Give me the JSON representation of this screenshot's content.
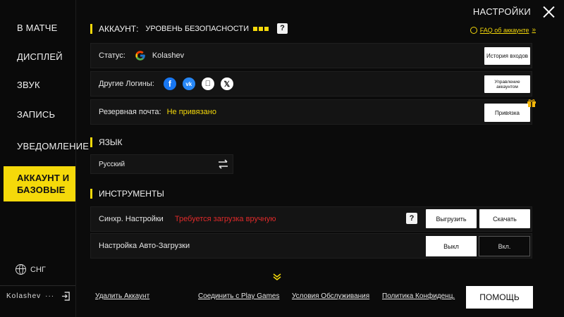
{
  "sidebar": {
    "items": [
      {
        "label": "В МАТЧЕ"
      },
      {
        "label": "ДИСПЛЕЙ"
      },
      {
        "label": "ЗВУК"
      },
      {
        "label": "ЗАПИСЬ"
      },
      {
        "label": "УВЕДОМЛЕНИЕ"
      },
      {
        "label_line1": "АККАУНТ И",
        "label_line2": "БАЗОВЫЕ",
        "active": true
      }
    ],
    "region": "СНГ",
    "username": "Kolashev",
    "user_more": "···"
  },
  "header": {
    "title": "НАСТРОЙКИ"
  },
  "account": {
    "title": "АККАУНТ:",
    "security_level": "УРОВЕНЬ БЕЗОПАСНОСТИ",
    "security_dots": 3,
    "help_icon": "?",
    "faq_label": "FAQ об аккаунте",
    "faq_chevron": "»",
    "status_label": "Статус:",
    "status_value": "Kolashev",
    "login_history_button": "История входов",
    "other_logins_label": "Другие Логины:",
    "manage_account_button": "Управление аккаунтом",
    "backup_email_label": "Резервная почта:",
    "backup_email_value": "Не привязано",
    "bind_button": "Привязка"
  },
  "language": {
    "title": "ЯЗЫК",
    "current": "Русский"
  },
  "tools": {
    "title": "ИНСТРУМЕНТЫ",
    "sync_label": "Синхр. Настройки",
    "sync_status": "Требуется загрузка вручную",
    "upload_button": "Выгрузить",
    "download_button": "Скачать",
    "autoload_label": "Настройка Авто-Загрузки",
    "autoload_off": "Выкл",
    "autoload_on": "Вкл."
  },
  "footer": {
    "delete_account": "Удалить Аккаунт",
    "connect_play_games": "Соединить с Play Games",
    "terms": "Условия Обслуживания",
    "privacy": "Политика Конфиденц.",
    "help_button": "ПОМОЩЬ"
  },
  "colors": {
    "accent": "#f5d90a",
    "background": "#0b0b0b",
    "row_bg": "#141414",
    "warning": "#e02a2a"
  }
}
